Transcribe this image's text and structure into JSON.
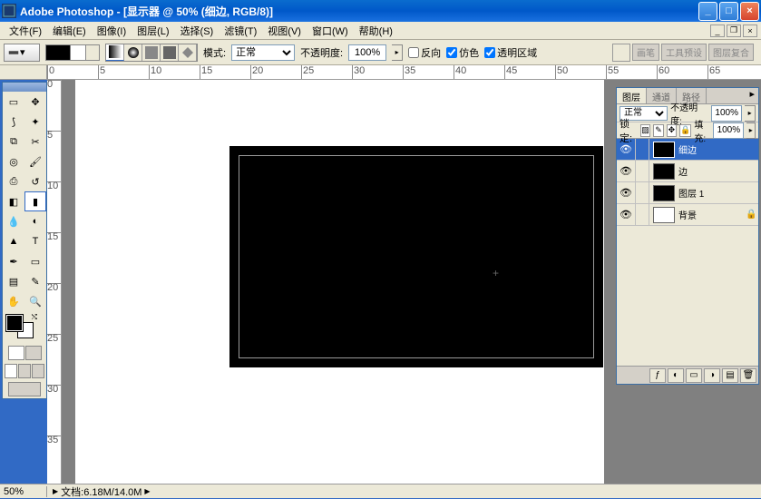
{
  "app_title": "Adobe Photoshop - [显示器 @ 50% (细边, RGB/8)]",
  "menu": [
    "文件(F)",
    "编辑(E)",
    "图像(I)",
    "图层(L)",
    "选择(S)",
    "滤镜(T)",
    "视图(V)",
    "窗口(W)",
    "帮助(H)"
  ],
  "options": {
    "mode_label": "模式:",
    "mode_value": "正常",
    "opacity_label": "不透明度:",
    "opacity_value": "100%",
    "reverse": "反向",
    "dither": "仿色",
    "transparency": "透明区域"
  },
  "palette_tabs": [
    "画笔",
    "工具预设",
    "图层复合"
  ],
  "ruler_ticks": [
    "0",
    "5",
    "10",
    "15",
    "20",
    "25",
    "30",
    "35",
    "40",
    "45",
    "50",
    "55",
    "60",
    "65"
  ],
  "vruler_ticks": [
    "0",
    "5",
    "10",
    "15",
    "20",
    "25",
    "30",
    "35",
    "40"
  ],
  "layers_panel": {
    "tabs": [
      "图层",
      "通道",
      "路径"
    ],
    "blend": "正常",
    "opacity_label": "不透明度:",
    "opacity": "100%",
    "lock_label": "锁定:",
    "fill_label": "填充:",
    "fill": "100%",
    "layers": [
      {
        "name": "细边",
        "thumb": "dark",
        "active": true
      },
      {
        "name": "边",
        "thumb": "black",
        "active": false
      },
      {
        "name": "图层 1",
        "thumb": "black",
        "active": false
      },
      {
        "name": "背景",
        "thumb": "white",
        "active": false,
        "locked": true
      }
    ]
  },
  "status": {
    "zoom": "50%",
    "docinfo": "文档:6.18M/14.0M"
  }
}
